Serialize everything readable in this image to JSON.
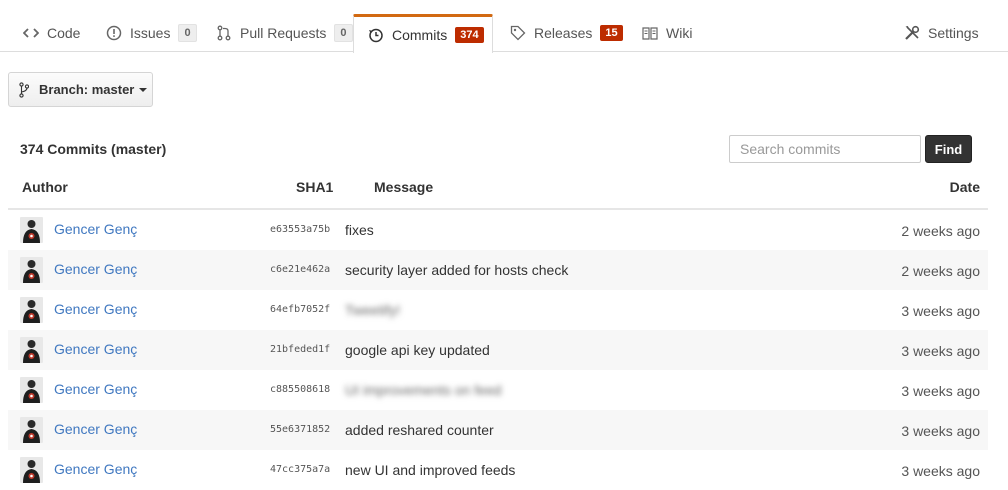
{
  "tabs": {
    "code": {
      "label": "Code",
      "icon": "code-icon"
    },
    "issues": {
      "label": "Issues",
      "count": "0",
      "icon": "issue-icon"
    },
    "pulls": {
      "label": "Pull Requests",
      "count": "0",
      "icon": "pull-request-icon"
    },
    "commits": {
      "label": "Commits",
      "count": "374",
      "icon": "history-icon"
    },
    "releases": {
      "label": "Releases",
      "count": "15",
      "icon": "tag-icon"
    },
    "wiki": {
      "label": "Wiki",
      "icon": "book-icon"
    },
    "settings": {
      "label": "Settings",
      "icon": "tools-icon"
    }
  },
  "branch": {
    "label": "Branch: master",
    "icon": "branch-icon"
  },
  "commit_count_label": "374 Commits (master)",
  "search": {
    "placeholder": "Search commits",
    "button_label": "Find"
  },
  "columns": {
    "author": "Author",
    "sha": "SHA1",
    "message": "Message",
    "date": "Date"
  },
  "commits": [
    {
      "author": "Gencer Genç",
      "sha": "e63553a75b",
      "message": "fixes",
      "date": "2 weeks ago"
    },
    {
      "author": "Gencer Genç",
      "sha": "c6e21e462a",
      "message": "security layer added for hosts check",
      "date": "2 weeks ago"
    },
    {
      "author": "Gencer Genç",
      "sha": "64efb7052f",
      "message": "Tweetify!",
      "date": "3 weeks ago",
      "blurred": true
    },
    {
      "author": "Gencer Genç",
      "sha": "21bfeded1f",
      "message": "google api key updated",
      "date": "3 weeks ago"
    },
    {
      "author": "Gencer Genç",
      "sha": "c885508618",
      "message": "UI improvements on feed",
      "date": "3 weeks ago",
      "blurred": true
    },
    {
      "author": "Gencer Genç",
      "sha": "55e6371852",
      "message": "added reshared counter",
      "date": "3 weeks ago"
    },
    {
      "author": "Gencer Genç",
      "sha": "47cc375a7a",
      "message": "new UI and improved feeds",
      "date": "3 weeks ago"
    }
  ],
  "colors": {
    "accent": "#d26911",
    "link": "#4078c0",
    "badge_red": "#bd2c00"
  }
}
